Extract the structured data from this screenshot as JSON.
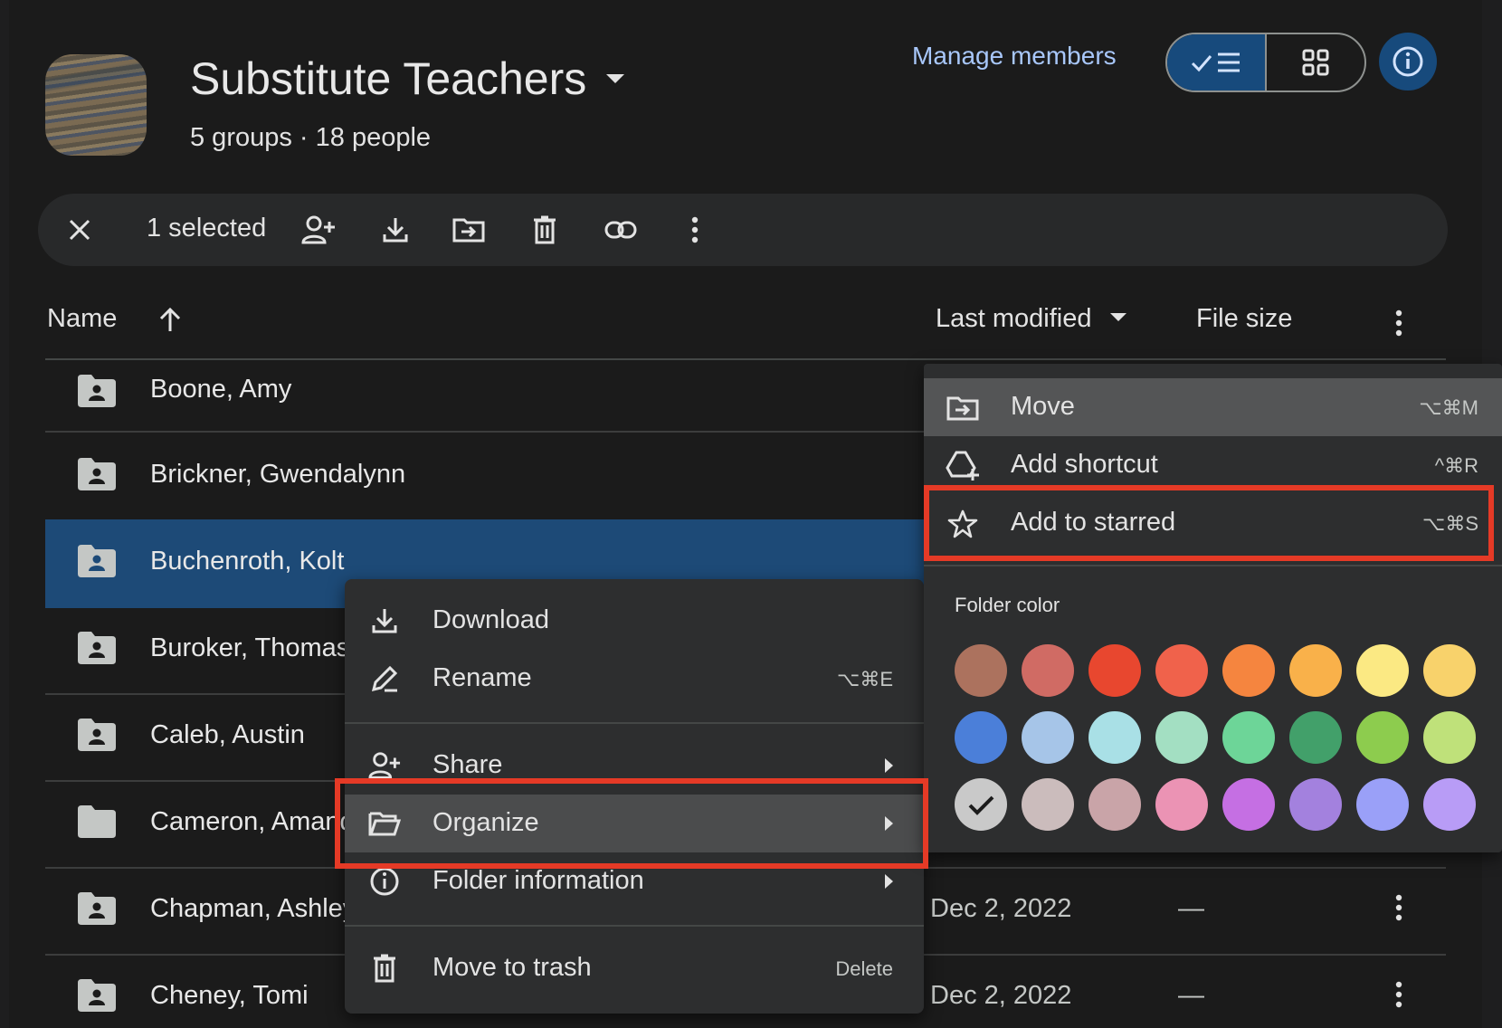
{
  "header": {
    "title": "Substitute Teachers",
    "subtitle": "5 groups · 18 people",
    "manage_members": "Manage members"
  },
  "selection_bar": {
    "count": "1 selected"
  },
  "columns": {
    "name": "Name",
    "last_modified": "Last modified",
    "file_size": "File size"
  },
  "rows": [
    {
      "name": "Boone, Amy",
      "date": "",
      "size": ""
    },
    {
      "name": "Brickner, Gwendalynn",
      "date": "",
      "size": ""
    },
    {
      "name": "Buchenroth, Kolt",
      "date": "",
      "size": ""
    },
    {
      "name": "Buroker, Thomas",
      "date": "",
      "size": ""
    },
    {
      "name": "Caleb, Austin",
      "date": "",
      "size": ""
    },
    {
      "name": "Cameron, Amanda",
      "date": "",
      "size": ""
    },
    {
      "name": "Chapman, Ashley",
      "date": "Dec 2, 2022",
      "size": "—"
    },
    {
      "name": "Cheney, Tomi",
      "date": "Dec 2, 2022",
      "size": "—"
    }
  ],
  "context_menu": {
    "download": "Download",
    "rename": "Rename",
    "rename_shortcut": "⌥⌘E",
    "share": "Share",
    "organize": "Organize",
    "folder_information": "Folder information",
    "move_to_trash": "Move to trash",
    "trash_shortcut": "Delete"
  },
  "organize_submenu": {
    "move": "Move",
    "move_shortcut": "⌥⌘M",
    "add_shortcut": "Add shortcut",
    "add_shortcut_shortcut": "^⌘R",
    "add_to_starred": "Add to starred",
    "starred_shortcut": "⌥⌘S",
    "folder_color_label": "Folder color",
    "colors": [
      "#ac725e",
      "#d06b64",
      "#e8472f",
      "#f0624b",
      "#f5853f",
      "#f9b14a",
      "#fbe983",
      "#f8d26b",
      "#4b7fd9",
      "#a6c5e8",
      "#a9e0e6",
      "#a3dfc2",
      "#6dd598",
      "#42a06a",
      "#8dcc4e",
      "#bfe17a",
      "#c9c9c9",
      "#cbbcbc",
      "#c9a4a8",
      "#eb93b4",
      "#c56fe3",
      "#a381de",
      "#9aa0f8",
      "#b89cf6"
    ],
    "selected_color_index": 16
  },
  "highlight_color": "#e53a26"
}
